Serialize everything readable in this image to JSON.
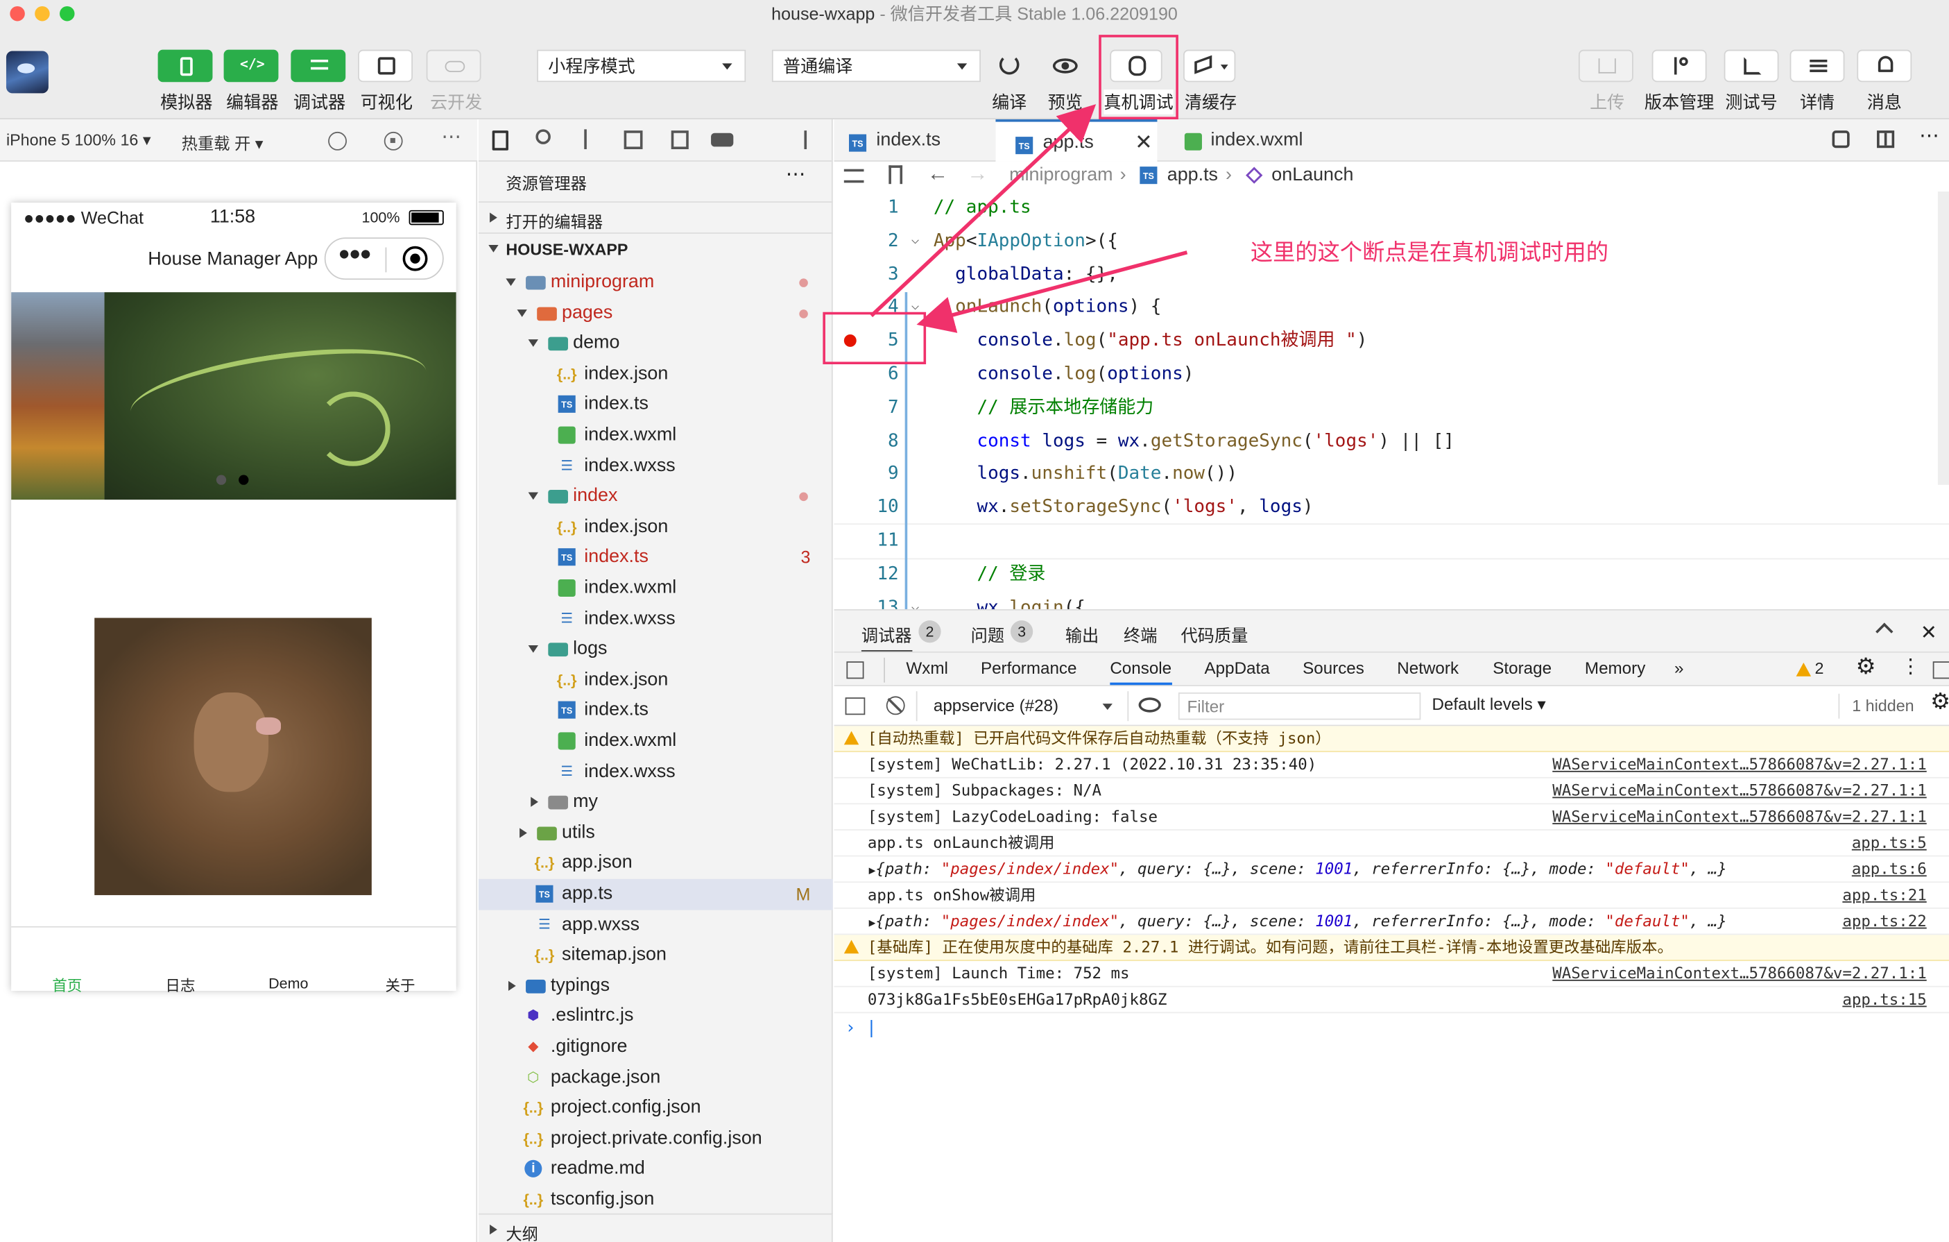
{
  "window": {
    "title": "house-wxapp",
    "subtitle": " - 微信开发者工具 Stable 1.06.2209190"
  },
  "toolbar": {
    "simulator": "模拟器",
    "editor": "编辑器",
    "debugger": "调试器",
    "visual": "可视化",
    "cloud": "云开发",
    "mode": "小程序模式",
    "compile_mode": "普通编译",
    "compile": "编译",
    "preview": "预览",
    "real_debug": "真机调试",
    "clear_cache": "清缓存",
    "upload": "上传",
    "version": "版本管理",
    "test_id": "测试号",
    "details": "详情",
    "messages": "消息"
  },
  "simulator": {
    "device": "iPhone 5 100% 16 ▾",
    "hot_reload": "热重载 开 ▾",
    "status": {
      "carrier": "●●●●● WeChat",
      "time": "11:58",
      "battery": "100%"
    },
    "nav_title": "House Manager App",
    "tabbar": [
      "首页",
      "日志",
      "Demo",
      "关于"
    ]
  },
  "explorer": {
    "title": "资源管理器",
    "open_editors": "打开的编辑器",
    "project": "HOUSE-WXAPP",
    "outline": "大纲",
    "rows": [
      {
        "label": "miniprogram",
        "depth": 1,
        "type": "folder-src",
        "open": true,
        "red": true,
        "dot": true
      },
      {
        "label": "pages",
        "depth": 2,
        "type": "folder-pages",
        "open": true,
        "red": true,
        "dot": true
      },
      {
        "label": "demo",
        "depth": 3,
        "type": "folder",
        "open": true
      },
      {
        "label": "index.json",
        "depth": 4,
        "type": "json"
      },
      {
        "label": "index.ts",
        "depth": 4,
        "type": "ts"
      },
      {
        "label": "index.wxml",
        "depth": 4,
        "type": "wxml"
      },
      {
        "label": "index.wxss",
        "depth": 4,
        "type": "wxss"
      },
      {
        "label": "index",
        "depth": 3,
        "type": "folder",
        "open": true,
        "red": true,
        "dot": true
      },
      {
        "label": "index.json",
        "depth": 4,
        "type": "json"
      },
      {
        "label": "index.ts",
        "depth": 4,
        "type": "ts",
        "red": true,
        "badge": "3"
      },
      {
        "label": "index.wxml",
        "depth": 4,
        "type": "wxml"
      },
      {
        "label": "index.wxss",
        "depth": 4,
        "type": "wxss"
      },
      {
        "label": "logs",
        "depth": 3,
        "type": "folder",
        "open": true
      },
      {
        "label": "index.json",
        "depth": 4,
        "type": "json"
      },
      {
        "label": "index.ts",
        "depth": 4,
        "type": "ts"
      },
      {
        "label": "index.wxml",
        "depth": 4,
        "type": "wxml"
      },
      {
        "label": "index.wxss",
        "depth": 4,
        "type": "wxss"
      },
      {
        "label": "my",
        "depth": 3,
        "type": "folder",
        "open": false
      },
      {
        "label": "utils",
        "depth": 2,
        "type": "folder-utils",
        "open": false
      },
      {
        "label": "app.json",
        "depth": 2,
        "type": "json"
      },
      {
        "label": "app.ts",
        "depth": 2,
        "type": "ts",
        "selected": true,
        "badge": "M"
      },
      {
        "label": "app.wxss",
        "depth": 2,
        "type": "wxss"
      },
      {
        "label": "sitemap.json",
        "depth": 2,
        "type": "json"
      },
      {
        "label": "typings",
        "depth": 1,
        "type": "folder-ts",
        "open": false
      },
      {
        "label": ".eslintrc.js",
        "depth": 1,
        "type": "eslint"
      },
      {
        "label": ".gitignore",
        "depth": 1,
        "type": "git"
      },
      {
        "label": "package.json",
        "depth": 1,
        "type": "npm"
      },
      {
        "label": "project.config.json",
        "depth": 1,
        "type": "json"
      },
      {
        "label": "project.private.config.json",
        "depth": 1,
        "type": "json"
      },
      {
        "label": "readme.md",
        "depth": 1,
        "type": "info"
      },
      {
        "label": "tsconfig.json",
        "depth": 1,
        "type": "json"
      }
    ]
  },
  "editor": {
    "tabs": [
      {
        "label": "index.ts"
      },
      {
        "label": "app.ts",
        "active": true
      },
      {
        "label": "index.wxml"
      }
    ],
    "breadcrumb": {
      "folder": "miniprogram",
      "file": "app.ts",
      "symbol": "onLaunch"
    },
    "lines": [
      {
        "n": "1",
        "html": "<span class='com'>// app.ts</span>"
      },
      {
        "n": "2",
        "html": "<span class='fn'>App</span><span class='pun'>&lt;</span><span class='ty'>IAppOption</span><span class='pun'>&gt;({</span>"
      },
      {
        "n": "3",
        "html": "  <span class='var'>globalData</span><span class='pun'>: {},</span>"
      },
      {
        "n": "4",
        "html": "  <span class='fn'>onLaunch</span><span class='pun'>(</span><span class='var'>options</span><span class='pun'>) {</span>"
      },
      {
        "n": "5",
        "html": "    <span class='var'>console</span>.<span class='fn'>log</span>(<span class='str'>\"app.ts onLaunch被调用 \"</span>)"
      },
      {
        "n": "6",
        "html": "    <span class='var'>console</span>.<span class='fn'>log</span>(<span class='var'>options</span>)"
      },
      {
        "n": "7",
        "html": "    <span class='com'>// 展示本地存储能力</span>"
      },
      {
        "n": "8",
        "html": "    <span class='kw'>const</span> <span class='var'>logs</span> = <span class='var'>wx</span>.<span class='fn'>getStorageSync</span>(<span class='str'>'logs'</span>) || []"
      },
      {
        "n": "9",
        "html": "    <span class='var'>logs</span>.<span class='fn'>unshift</span>(<span class='ty'>Date</span>.<span class='fn'>now</span>())"
      },
      {
        "n": "10",
        "html": "    <span class='var'>wx</span>.<span class='fn'>setStorageSync</span>(<span class='str'>'logs'</span>, <span class='var'>logs</span>)"
      },
      {
        "n": "11",
        "html": ""
      },
      {
        "n": "12",
        "html": "    <span class='com'>// 登录</span>"
      },
      {
        "n": "13",
        "html": "    <span class='var'>wx</span>.<span class='fn'>login</span>({"
      }
    ]
  },
  "annotation": {
    "text": "这里的这个断点是在真机调试时用的"
  },
  "devtools": {
    "tabs": [
      {
        "label": "调试器",
        "badge": "2"
      },
      {
        "label": "问题",
        "badge": "3"
      },
      {
        "label": "输出"
      },
      {
        "label": "终端"
      },
      {
        "label": "代码质量"
      }
    ],
    "panels": [
      "Wxml",
      "Performance",
      "Console",
      "AppData",
      "Sources",
      "Network",
      "Storage",
      "Memory",
      "»"
    ],
    "warn_count": "2",
    "context": "appservice (#28)",
    "filter_placeholder": "Filter",
    "levels": "Default levels ▾",
    "hidden": "1 hidden"
  },
  "console": [
    {
      "type": "warn",
      "msg": "[自动热重载] 已开启代码文件保存后自动热重载（不支持 json）",
      "src": ""
    },
    {
      "type": "log",
      "msg": "[system] WeChatLib: 2.27.1 (2022.10.31 23:35:40)",
      "src": "WAServiceMainContext…57866087&v=2.27.1:1"
    },
    {
      "type": "log",
      "msg": "[system] Subpackages: N/A",
      "src": "WAServiceMainContext…57866087&v=2.27.1:1"
    },
    {
      "type": "log",
      "msg": "[system] LazyCodeLoading: false",
      "src": "WAServiceMainContext…57866087&v=2.27.1:1"
    },
    {
      "type": "log",
      "msg": "app.ts onLaunch被调用",
      "src": "app.ts:5"
    },
    {
      "type": "obj",
      "msg": "",
      "src": "app.ts:6"
    },
    {
      "type": "log",
      "msg": "app.ts onShow被调用",
      "src": "app.ts:21"
    },
    {
      "type": "obj",
      "msg": "",
      "src": "app.ts:22"
    },
    {
      "type": "warn",
      "msg": "[基础库] 正在使用灰度中的基础库 2.27.1 进行调试。如有问题，请前往工具栏-详情-本地设置更改基础库版本。",
      "src": ""
    },
    {
      "type": "log",
      "msg": "[system] Launch Time: 752 ms",
      "src": "WAServiceMainContext…57866087&v=2.27.1:1"
    },
    {
      "type": "log",
      "msg": "073jk8Ga1Fs5bE0sEHGa17pRpA0jk8GZ",
      "src": "app.ts:15"
    }
  ],
  "console_obj": {
    "path_key": "path",
    "path_val": "\"pages/index/index\"",
    "rest": "query: {…}, scene: ",
    "scene": "1001",
    "rest2": ", referrerInfo: {…}, mode: ",
    "mode": "\"default\"",
    "tail": ", …}"
  },
  "colors": {
    "green": "#2aae4a",
    "accent": "#f0316b",
    "breakpoint": "#e51400",
    "link": "#2f74c0"
  }
}
